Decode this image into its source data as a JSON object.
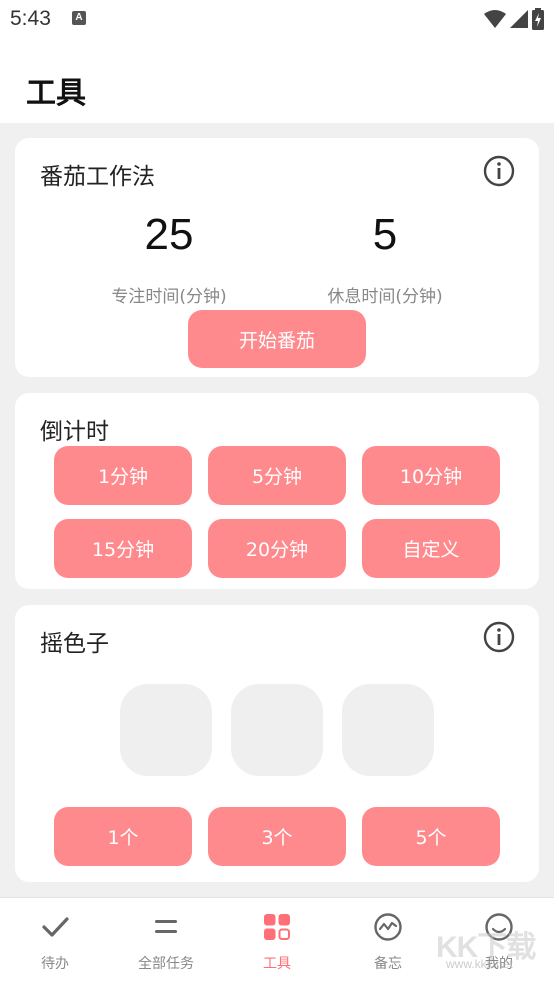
{
  "status_bar": {
    "time": "5:43",
    "notification_badge": "A"
  },
  "header": {
    "title": "工具"
  },
  "pomodoro": {
    "title": "番茄工作法",
    "focus_value": "25",
    "focus_label": "专注时间(分钟)",
    "rest_value": "5",
    "rest_label": "休息时间(分钟)",
    "start_label": "开始番茄"
  },
  "countdown": {
    "title": "倒计时",
    "options": [
      "1分钟",
      "5分钟",
      "10分钟",
      "15分钟",
      "20分钟",
      "自定义"
    ]
  },
  "dice": {
    "title": "摇色子",
    "count_options": [
      "1个",
      "3个",
      "5个"
    ]
  },
  "bottom_nav": {
    "items": [
      {
        "label": "待办",
        "icon": "check-icon"
      },
      {
        "label": "全部任务",
        "icon": "list-icon"
      },
      {
        "label": "工具",
        "icon": "grid-icon"
      },
      {
        "label": "备忘",
        "icon": "pulse-circle-icon"
      },
      {
        "label": "我的",
        "icon": "smile-icon"
      }
    ],
    "active_index": 2
  },
  "watermark": {
    "logo": "KK下载",
    "url": "www.kkx.net"
  },
  "colors": {
    "accent": "#ff8a8e",
    "active_nav": "#ff6f78",
    "background": "#f0f0f0"
  }
}
